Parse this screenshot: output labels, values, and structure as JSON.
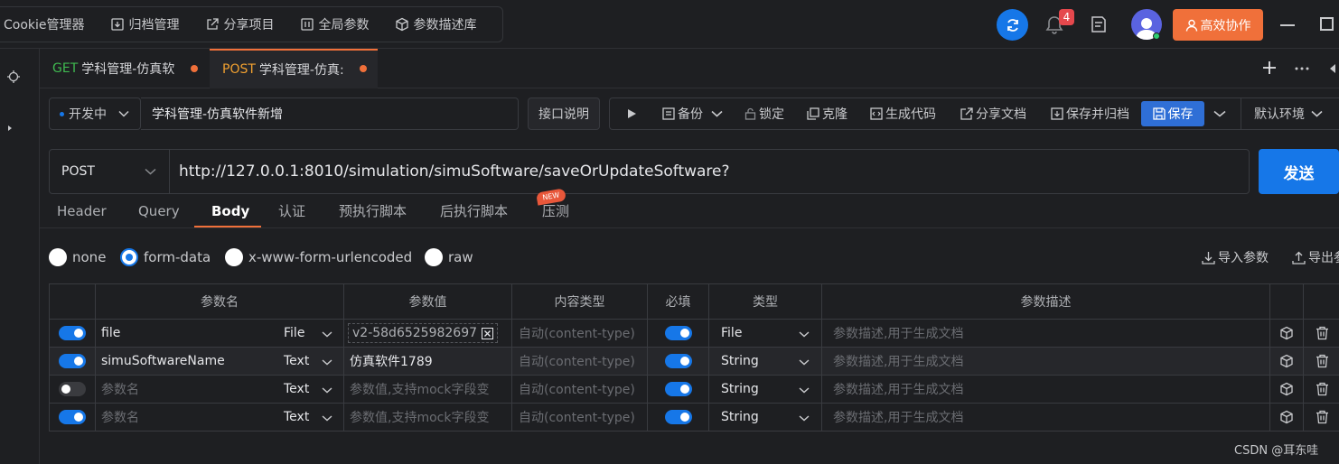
{
  "topnav": {
    "items": [
      {
        "label": "Cookie管理器",
        "icon": ""
      },
      {
        "label": "归档管理",
        "icon": "archive-icon"
      },
      {
        "label": "分享项目",
        "icon": "share-icon"
      },
      {
        "label": "全局参数",
        "icon": "params-icon"
      },
      {
        "label": "参数描述库",
        "icon": "cube-icon"
      }
    ]
  },
  "header": {
    "notification_count": "4",
    "collab_label": "高效协作"
  },
  "tabs": [
    {
      "method": "GET",
      "name": "学科管理-仿真软",
      "method_color": "#3fb950"
    },
    {
      "method": "POST",
      "name": "学科管理-仿真:",
      "method_color": "#f0a030"
    }
  ],
  "request": {
    "status": "开发中",
    "name": "学科管理-仿真软件新增",
    "api_desc_label": "接口说明",
    "actions": {
      "backup": "备份",
      "lock": "锁定",
      "clone": "克隆",
      "gen_code": "生成代码",
      "share_doc": "分享文档",
      "save_archive": "保存并归档",
      "save": "保存",
      "env": "默认环境"
    },
    "method": "POST",
    "url": "http://127.0.0.1:8010/simulation/simuSoftware/saveOrUpdateSoftware?",
    "send_label": "发送"
  },
  "body_tabs": [
    "Header",
    "Query",
    "Body",
    "认证",
    "预执行脚本",
    "后执行脚本",
    "压测"
  ],
  "new_badge": "NEW",
  "body_modes": [
    "none",
    "form-data",
    "x-www-form-urlencoded",
    "raw"
  ],
  "body_mode_selected": "form-data",
  "import_label": "导入参数",
  "export_label": "导出参",
  "table": {
    "headers": [
      "参数名",
      "参数值",
      "内容类型",
      "必填",
      "类型",
      "参数描述"
    ],
    "rows": [
      {
        "enabled": true,
        "name": "file",
        "name_is_placeholder": false,
        "param_type": "File",
        "value": "v2-58d6525982697",
        "value_is_placeholder": false,
        "content_type": "自动(content-type)",
        "required": true,
        "data_type": "File",
        "desc": "参数描述,用于生成文档"
      },
      {
        "enabled": true,
        "name": "simuSoftwareName",
        "name_is_placeholder": false,
        "param_type": "Text",
        "value": "仿真软件1789",
        "value_is_placeholder": false,
        "content_type": "自动(content-type)",
        "required": true,
        "data_type": "String",
        "desc": "参数描述,用于生成文档"
      },
      {
        "enabled": false,
        "name": "参数名",
        "name_is_placeholder": true,
        "param_type": "Text",
        "value": "参数值,支持mock字段变",
        "value_is_placeholder": true,
        "content_type": "自动(content-type)",
        "required": true,
        "data_type": "String",
        "desc": "参数描述,用于生成文档"
      },
      {
        "enabled": true,
        "name": "参数名",
        "name_is_placeholder": true,
        "param_type": "Text",
        "value": "参数值,支持mock字段变",
        "value_is_placeholder": true,
        "content_type": "自动(content-type)",
        "required": true,
        "data_type": "String",
        "desc": "参数描述,用于生成文档"
      }
    ]
  },
  "watermark": "CSDN @耳东哇",
  "colors": {
    "accent": "#1677e8",
    "orange": "#f0703a",
    "bg": "#1e1f22"
  }
}
